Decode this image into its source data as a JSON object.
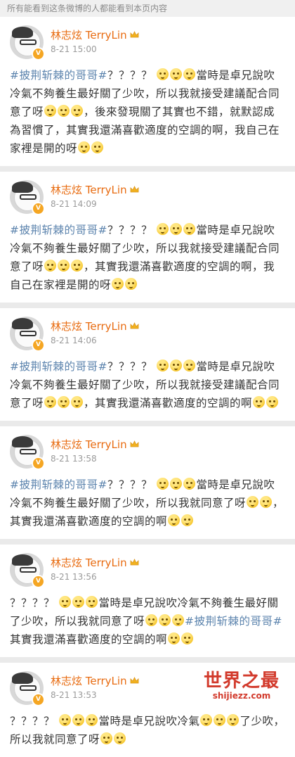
{
  "notice": "所有能看到这条微博的人都能看到本页内容",
  "posts": [
    {
      "author": "林志炫 TerryLin",
      "time": "8-21 15:00",
      "body": [
        {
          "t": "hashtag",
          "v": "#披荆斩棘的哥哥#"
        },
        {
          "t": "text",
          "v": "？？？？ "
        },
        {
          "t": "emoji"
        },
        {
          "t": "emoji"
        },
        {
          "t": "emoji"
        },
        {
          "t": "text",
          "v": "當時是卓兄說吹冷氣不夠養生最好關了少吹，所以我就接受建議配合同意了呀"
        },
        {
          "t": "emoji"
        },
        {
          "t": "emoji"
        },
        {
          "t": "emoji"
        },
        {
          "t": "text",
          "v": "，後來發現關了其實也不錯，就默認成為習慣了，其實我還滿喜歡適度的空調的啊，我自己在家裡是開的呀"
        },
        {
          "t": "emoji"
        },
        {
          "t": "emoji"
        }
      ]
    },
    {
      "author": "林志炫 TerryLin",
      "time": "8-21 14:09",
      "body": [
        {
          "t": "hashtag",
          "v": "#披荆斩棘的哥哥#"
        },
        {
          "t": "text",
          "v": "？？？？ "
        },
        {
          "t": "emoji"
        },
        {
          "t": "emoji"
        },
        {
          "t": "emoji"
        },
        {
          "t": "text",
          "v": "當時是卓兄說吹冷氣不夠養生最好關了少吹，所以我就接受建議配合同意了呀"
        },
        {
          "t": "emoji"
        },
        {
          "t": "emoji"
        },
        {
          "t": "emoji"
        },
        {
          "t": "text",
          "v": "，其實我還滿喜歡適度的空調的啊，我自己在家裡是開的呀"
        },
        {
          "t": "emoji"
        },
        {
          "t": "emoji"
        }
      ]
    },
    {
      "author": "林志炫 TerryLin",
      "time": "8-21 14:06",
      "body": [
        {
          "t": "hashtag",
          "v": "#披荆斩棘的哥哥#"
        },
        {
          "t": "text",
          "v": "？？？？ "
        },
        {
          "t": "emoji"
        },
        {
          "t": "emoji"
        },
        {
          "t": "emoji"
        },
        {
          "t": "text",
          "v": "當時是卓兄說吹冷氣不夠養生最好關了少吹，所以我就接受建議配合同意了呀"
        },
        {
          "t": "emoji"
        },
        {
          "t": "emoji"
        },
        {
          "t": "emoji"
        },
        {
          "t": "text",
          "v": "，其實我還滿喜歡適度的空調的啊"
        },
        {
          "t": "emoji"
        },
        {
          "t": "emoji"
        }
      ]
    },
    {
      "author": "林志炫 TerryLin",
      "time": "8-21 13:58",
      "body": [
        {
          "t": "hashtag",
          "v": "#披荆斩棘的哥哥#"
        },
        {
          "t": "text",
          "v": "？？？？ "
        },
        {
          "t": "emoji"
        },
        {
          "t": "emoji"
        },
        {
          "t": "emoji"
        },
        {
          "t": "text",
          "v": "當時是卓兄說吹冷氣不夠養生最好關了少吹，所以我就同意了呀"
        },
        {
          "t": "emoji"
        },
        {
          "t": "emoji"
        },
        {
          "t": "text",
          "v": "，其實我還滿喜歡適度的空調的啊"
        },
        {
          "t": "emoji"
        },
        {
          "t": "emoji"
        }
      ]
    },
    {
      "author": "林志炫 TerryLin",
      "time": "8-21 13:56",
      "body": [
        {
          "t": "text",
          "v": "？？？？ "
        },
        {
          "t": "emoji"
        },
        {
          "t": "emoji"
        },
        {
          "t": "emoji"
        },
        {
          "t": "text",
          "v": "當時是卓兄說吹冷氣不夠養生最好關了少吹，所以我就同意了呀"
        },
        {
          "t": "emoji"
        },
        {
          "t": "emoji"
        },
        {
          "t": "emoji"
        },
        {
          "t": "hashtag",
          "v": "#披荆斩棘的哥哥#"
        },
        {
          "t": "text",
          "v": " 其實我還滿喜歡適度的空調的啊"
        },
        {
          "t": "emoji"
        },
        {
          "t": "emoji"
        }
      ]
    },
    {
      "author": "林志炫 TerryLin",
      "time": "8-21 13:53",
      "body": [
        {
          "t": "text",
          "v": "？？？？ "
        },
        {
          "t": "emoji"
        },
        {
          "t": "emoji"
        },
        {
          "t": "emoji"
        },
        {
          "t": "text",
          "v": "當時是卓兄說吹冷氣"
        },
        {
          "t": "emoji"
        },
        {
          "t": "emoji"
        },
        {
          "t": "emoji"
        },
        {
          "t": "text",
          "v": "了少吹，所以我就同意了呀"
        },
        {
          "t": "emoji"
        },
        {
          "t": "emoji"
        }
      ]
    }
  ],
  "watermark": {
    "title": "世界之最",
    "url": "shijiezz.com"
  },
  "colors": {
    "author": "#e86b10",
    "hashtag": "#5b83ad",
    "badge": "#f5a623",
    "watermark": "#d23a2c"
  },
  "icons": {
    "avatar_badge": "v-verified-badge",
    "name_badge": "crown-icon",
    "emoji": "smiling-face-emoji"
  }
}
